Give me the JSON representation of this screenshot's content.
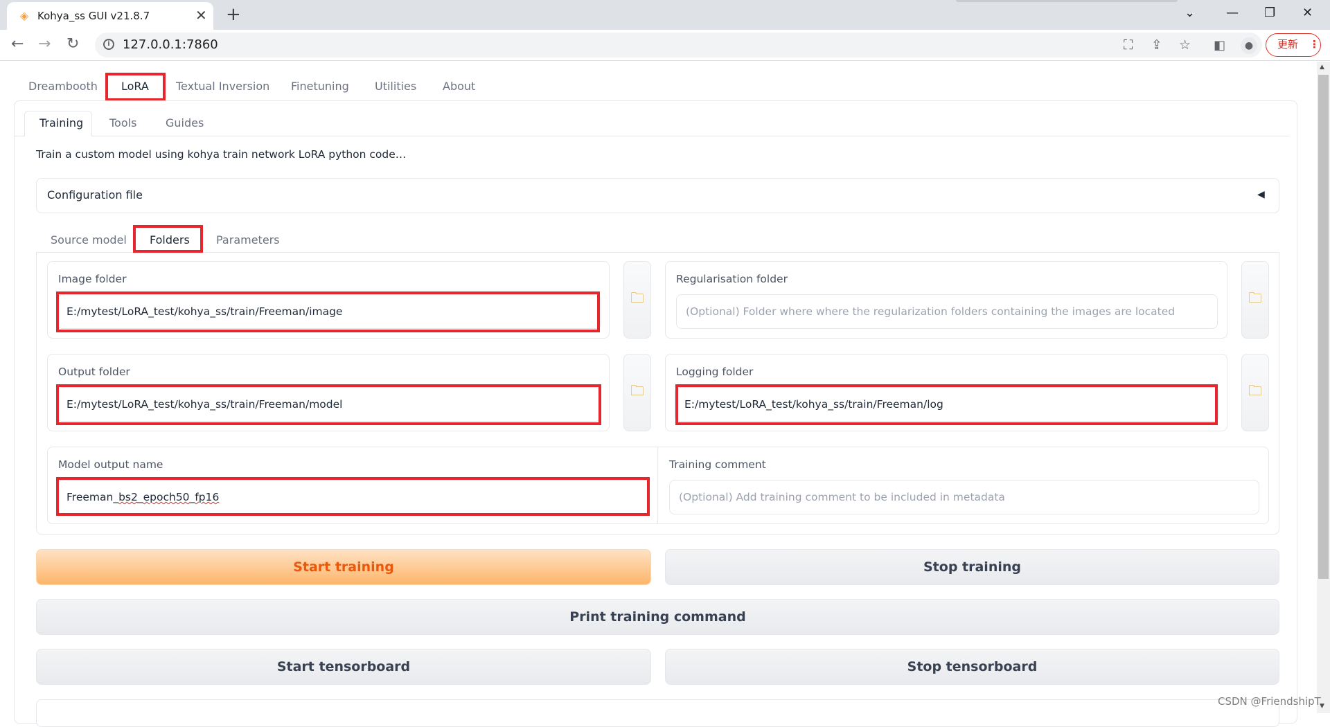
{
  "browser": {
    "tab_title": "Kohya_ss GUI v21.8.7",
    "url": "127.0.0.1:7860",
    "update_label": "更新"
  },
  "app": {
    "top_tabs": [
      "Dreambooth",
      "LoRA",
      "Textual Inversion",
      "Finetuning",
      "Utilities",
      "About"
    ],
    "active_top_tab": "LoRA",
    "sub_tabs": [
      "Training",
      "Tools",
      "Guides"
    ],
    "active_sub_tab": "Training",
    "description": "Train a custom model using kohya train network LoRA python code…",
    "config_accordion_label": "Configuration file",
    "inner_tabs": [
      "Source model",
      "Folders",
      "Parameters"
    ],
    "active_inner_tab": "Folders",
    "fields": {
      "image_folder": {
        "label": "Image folder",
        "value": "E:/mytest/LoRA_test/kohya_ss/train/Freeman/image"
      },
      "reg_folder": {
        "label": "Regularisation folder",
        "placeholder": "(Optional) Folder where where the regularization folders containing the images are located"
      },
      "output_folder": {
        "label": "Output folder",
        "value": "E:/mytest/LoRA_test/kohya_ss/train/Freeman/model"
      },
      "logging_folder": {
        "label": "Logging folder",
        "value": "E:/mytest/LoRA_test/kohya_ss/train/Freeman/log"
      },
      "model_output_name": {
        "label": "Model output name",
        "value_a": "Freeman_",
        "value_b": "bs2",
        "value_c": "_",
        "value_d": "epoch50",
        "value_e": "_",
        "value_f": "fp16"
      },
      "training_comment": {
        "label": "Training comment",
        "placeholder": "(Optional) Add training comment to be included in metadata"
      }
    },
    "buttons": {
      "start_training": "Start training",
      "stop_training": "Stop training",
      "print_command": "Print training command",
      "start_tensorboard": "Start tensorboard",
      "stop_tensorboard": "Stop tensorboard"
    }
  },
  "watermark": "CSDN @FriendshipT"
}
